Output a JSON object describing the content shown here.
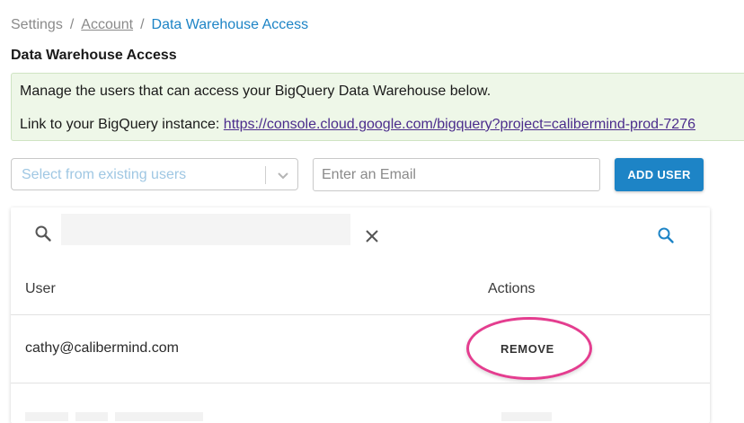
{
  "breadcrumb": {
    "items": [
      "Settings",
      "Account",
      "Data Warehouse Access"
    ],
    "separator": "/"
  },
  "page_title": "Data Warehouse Access",
  "info": {
    "line1": "Manage the users that can access your BigQuery Data Warehouse below.",
    "link_prefix": "Link to your BigQuery instance:",
    "link_text": "https://console.cloud.google.com/bigquery?project=calibermind-prod-7276"
  },
  "form": {
    "select_placeholder": "Select from existing users",
    "email_placeholder": "Enter an Email",
    "add_button_label": "ADD USER"
  },
  "table": {
    "search_value": "",
    "columns": [
      "User",
      "Actions"
    ],
    "rows": [
      {
        "user": "cathy@calibermind.com",
        "action": "REMOVE"
      }
    ]
  },
  "colors": {
    "accent": "#1d84c6",
    "info_bg": "#eef7e8",
    "highlight": "#e43d8f",
    "link": "#4b2c8c"
  }
}
